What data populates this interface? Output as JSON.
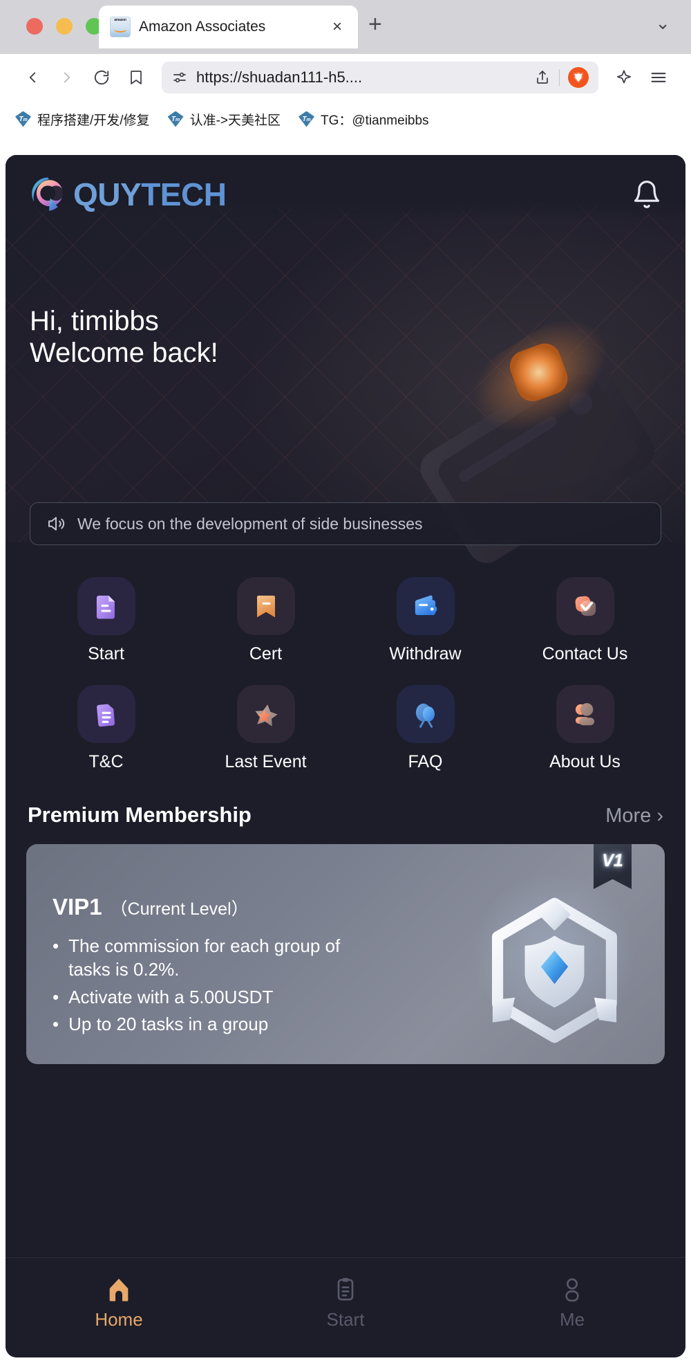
{
  "browser": {
    "tab": {
      "title": "Amazon Associates",
      "favicon": "amazon-icon",
      "close_label": "×"
    },
    "new_tab_label": "+",
    "tab_list_label": "⌄",
    "nav": {
      "back": "‹",
      "forward": "›",
      "reload": "reload-icon",
      "bookmark": "bookmark-icon",
      "site_settings": "site-settings-icon",
      "share": "share-icon",
      "shields": "brave-shields-icon",
      "leo": "leo-ai-icon",
      "menu": "hamburger-menu-icon"
    },
    "url": "https://shuadan111-h5....",
    "bookmarks": [
      {
        "icon": "tm-icon",
        "label": "程序搭建/开发/修复"
      },
      {
        "icon": "tm-icon",
        "label": "认准->天美社区"
      },
      {
        "icon": "tm-icon",
        "label": "TG：@tianmeibbs"
      }
    ]
  },
  "app": {
    "brand": {
      "name_part1": "QUY",
      "name_part2": "TECH",
      "logo_icon": "quytech-q-logo"
    },
    "notification_icon": "bell-icon",
    "greeting_line1": "Hi, timibbs",
    "greeting_line2": "Welcome back!",
    "notice": {
      "icon": "speaker-icon",
      "text": "We focus on the development of side businesses"
    },
    "menu": [
      {
        "label": "Start",
        "icon": "document-icon",
        "tone": "purple"
      },
      {
        "label": "Cert",
        "icon": "bookmark-ribbon-icon",
        "tone": "orange"
      },
      {
        "label": "Withdraw",
        "icon": "wallet-icon",
        "tone": "blue"
      },
      {
        "label": "Contact Us",
        "icon": "message-check-icon",
        "tone": "coral"
      },
      {
        "label": "T&C",
        "icon": "terms-document-icon",
        "tone": "purple"
      },
      {
        "label": "Last Event",
        "icon": "star-icon",
        "tone": "orange"
      },
      {
        "label": "FAQ",
        "icon": "balloon-question-icon",
        "tone": "blue"
      },
      {
        "label": "About Us",
        "icon": "people-icon",
        "tone": "coral"
      }
    ],
    "section": {
      "title": "Premium Membership",
      "more_label": "More",
      "more_chevron": "›"
    },
    "vip": {
      "badge": "V1",
      "level": "VIP1",
      "level_note": "（Current Level）",
      "shield_icon": "vip-shield-icon",
      "benefits": [
        "The commission for each group of tasks is 0.2%.",
        "Activate with a 5.00USDT",
        "Up to 20 tasks in a group"
      ]
    },
    "tabbar": [
      {
        "label": "Home",
        "icon": "home-icon",
        "state": "active"
      },
      {
        "label": "Start",
        "icon": "clipboard-icon",
        "state": "inactive"
      },
      {
        "label": "Me",
        "icon": "person-icon",
        "state": "inactive"
      }
    ],
    "colors": {
      "background": "#1c1d29",
      "accent": "#e8a86a",
      "inactive": "#585a6b",
      "brand_blue": "#6f9fd8"
    }
  }
}
